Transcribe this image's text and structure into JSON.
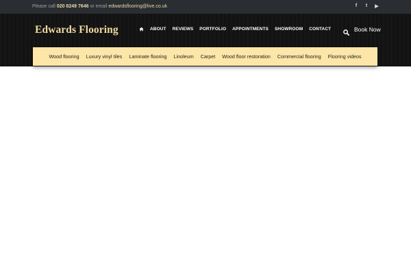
{
  "topbar": {
    "call_prefix": "Please call",
    "phone": "020 8249 7646",
    "email_prefix": "or email",
    "email": "edwardsflooring@live.co.uk",
    "social": [
      {
        "icon": "facebook-icon",
        "glyph": "f"
      },
      {
        "icon": "twitter-icon",
        "glyph": "t"
      },
      {
        "icon": "youtube-icon",
        "glyph": "▶"
      }
    ]
  },
  "header": {
    "brand": "Edwards Flooring",
    "nav": [
      {
        "label": "ABOUT"
      },
      {
        "label": "REVIEWS"
      },
      {
        "label": "PORTFOLIO"
      },
      {
        "label": "APPOINTMENTS"
      },
      {
        "label": "SHOWROOM"
      },
      {
        "label": "CONTACT"
      }
    ],
    "book_now": "Book Now"
  },
  "categories": [
    {
      "label": "Wood flooring"
    },
    {
      "label": "Luxury vinyl tiles"
    },
    {
      "label": "Laminate flooring"
    },
    {
      "label": "Linoleum"
    },
    {
      "label": "Carpet"
    },
    {
      "label": "Wood floor restoration"
    },
    {
      "label": "Commercial flooring"
    },
    {
      "label": "Flooring videos"
    }
  ],
  "colors": {
    "topbar_bg": "#2a2d31",
    "header_bg": "#141414",
    "brand": "#efd9a0",
    "category_bar": "#fde6a8"
  }
}
